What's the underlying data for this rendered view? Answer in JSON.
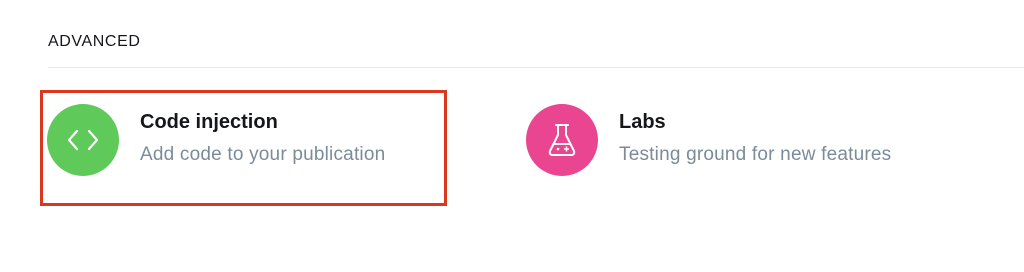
{
  "section": {
    "title": "ADVANCED"
  },
  "items": [
    {
      "title": "Code injection",
      "description": "Add code to your publication",
      "icon": "code-icon",
      "color": "#5fc95a"
    },
    {
      "title": "Labs",
      "description": "Testing ground for new features",
      "icon": "flask-icon",
      "color": "#ea4591"
    }
  ],
  "highlight": {
    "color": "#d9381e",
    "target": "Code injection"
  }
}
